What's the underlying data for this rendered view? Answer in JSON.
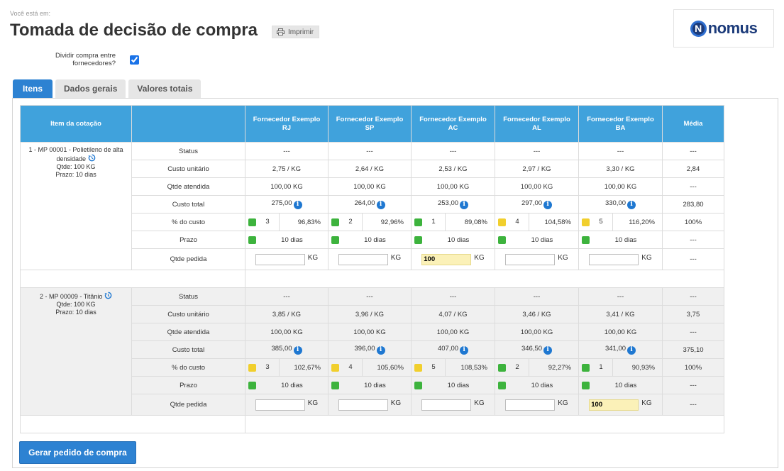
{
  "breadcrumb": "Você está em:",
  "title": "Tomada de decisão de compra",
  "print_label": "Imprimir",
  "logo_text": "nomus",
  "logo_letter": "N",
  "split_label": "Dividir compra entre fornecedores?",
  "split_checked": true,
  "tabs": [
    {
      "label": "Itens",
      "active": true
    },
    {
      "label": "Dados gerais",
      "active": false
    },
    {
      "label": "Valores totais",
      "active": false
    }
  ],
  "columns": {
    "item": "Item da cotação",
    "suppliers": [
      "Fornecedor Exemplo RJ",
      "Fornecedor Exemplo SP",
      "Fornecedor Exemplo AC",
      "Fornecedor Exemplo AL",
      "Fornecedor Exemplo BA"
    ],
    "average": "Média"
  },
  "row_labels": {
    "status": "Status",
    "custo_unitario": "Custo unitário",
    "qtde_atendida": "Qtde atendida",
    "custo_total": "Custo total",
    "pct_custo": "% do custo",
    "prazo": "Prazo",
    "qtde_pedida": "Qtde pedida"
  },
  "unit": "KG",
  "items": [
    {
      "name": "1 - MP 00001 - Polietileno de alta densidade",
      "qtde": "Qtde: 100 KG",
      "prazo": "Prazo: 10 dias",
      "status": [
        "---",
        "---",
        "---",
        "---",
        "---",
        "---"
      ],
      "custo_unitario": [
        "2,75 / KG",
        "2,64 / KG",
        "2,53 / KG",
        "2,97 / KG",
        "3,30 / KG",
        "2,84"
      ],
      "qtde_atendida": [
        "100,00 KG",
        "100,00 KG",
        "100,00 KG",
        "100,00 KG",
        "100,00 KG",
        "---"
      ],
      "custo_total": [
        "275,00",
        "264,00",
        "253,00",
        "297,00",
        "330,00",
        "283,80"
      ],
      "pct_rank": [
        "3",
        "2",
        "1",
        "4",
        "5"
      ],
      "pct_color": [
        "green",
        "green",
        "green",
        "yellow",
        "yellow"
      ],
      "pct_value": [
        "96,83%",
        "92,96%",
        "89,08%",
        "104,58%",
        "116,20%",
        "100%"
      ],
      "prazo_values": [
        "10 dias",
        "10 dias",
        "10 dias",
        "10 dias",
        "10 dias",
        "---"
      ],
      "qtde_pedida": [
        "",
        "",
        "100",
        "",
        ""
      ],
      "qtde_pedida_avg": "---"
    },
    {
      "name": "2 - MP 00009 - Titânio",
      "qtde": "Qtde: 100 KG",
      "prazo": "Prazo: 10 dias",
      "status": [
        "---",
        "---",
        "---",
        "---",
        "---",
        "---"
      ],
      "custo_unitario": [
        "3,85 / KG",
        "3,96 / KG",
        "4,07 / KG",
        "3,46 / KG",
        "3,41 / KG",
        "3,75"
      ],
      "qtde_atendida": [
        "100,00 KG",
        "100,00 KG",
        "100,00 KG",
        "100,00 KG",
        "100,00 KG",
        "---"
      ],
      "custo_total": [
        "385,00",
        "396,00",
        "407,00",
        "346,50",
        "341,00",
        "375,10"
      ],
      "pct_rank": [
        "3",
        "4",
        "5",
        "2",
        "1"
      ],
      "pct_color": [
        "yellow",
        "yellow",
        "yellow",
        "green",
        "green"
      ],
      "pct_value": [
        "102,67%",
        "105,60%",
        "108,53%",
        "92,27%",
        "90,93%",
        "100%"
      ],
      "prazo_values": [
        "10 dias",
        "10 dias",
        "10 dias",
        "10 dias",
        "10 dias",
        "---"
      ],
      "qtde_pedida": [
        "",
        "",
        "",
        "",
        "100"
      ],
      "qtde_pedida_avg": "---"
    }
  ],
  "gerar_label": "Gerar pedido de compra"
}
